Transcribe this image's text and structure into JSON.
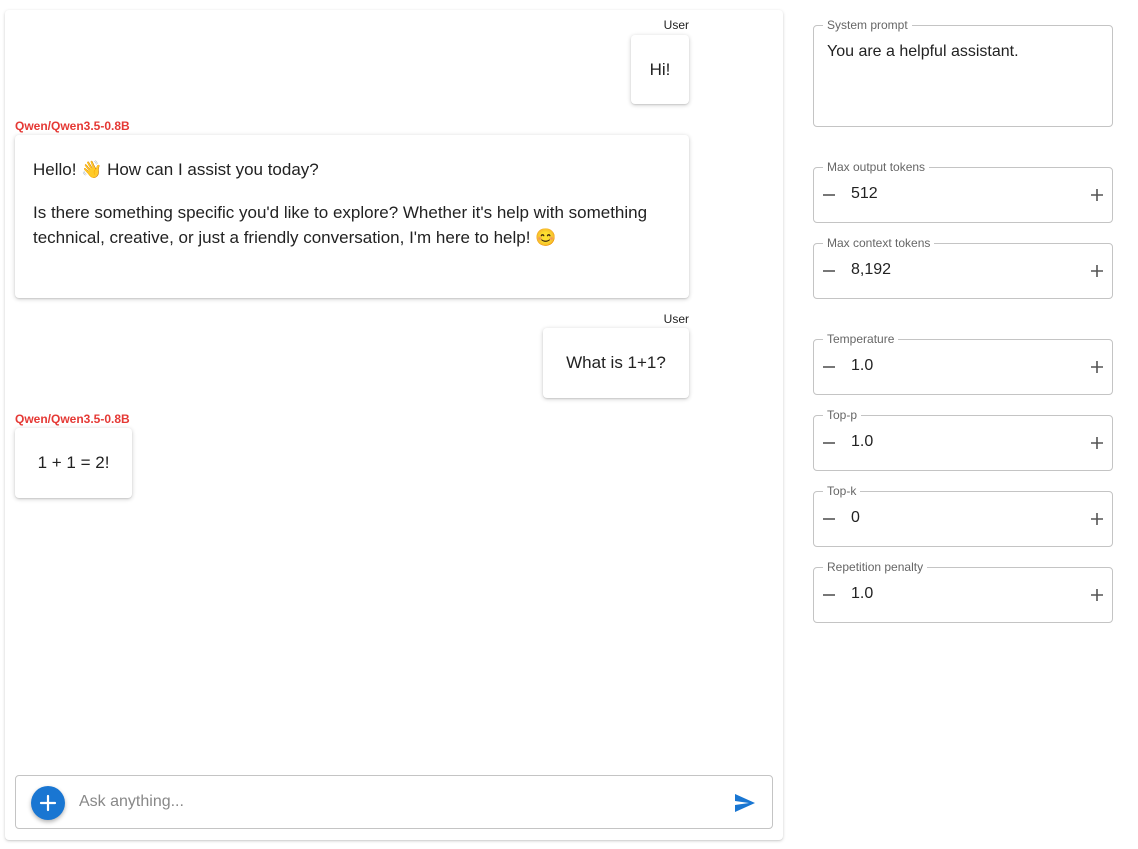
{
  "chat": {
    "messages": [
      {
        "role": "user",
        "sender": "User",
        "paragraphs": [
          "Hi!"
        ]
      },
      {
        "role": "assistant",
        "sender": "Qwen/Qwen3.5-0.8B",
        "paragraphs": [
          "Hello! 👋 How can I assist you today?",
          "Is there something specific you'd like to explore? Whether it's help with something technical, creative, or just a friendly conversation, I'm here to help! 😊"
        ]
      },
      {
        "role": "user",
        "sender": "User",
        "paragraphs": [
          "What is 1+1?"
        ]
      },
      {
        "role": "assistant",
        "sender": "Qwen/Qwen3.5-0.8B",
        "paragraphs": [
          "1 + 1 = 2!"
        ]
      }
    ],
    "input": {
      "placeholder": "Ask anything...",
      "value": ""
    }
  },
  "settings": {
    "system_prompt": {
      "label": "System prompt",
      "value": "You are a helpful assistant."
    },
    "max_output_tokens": {
      "label": "Max output tokens",
      "value": "512"
    },
    "max_context_tokens": {
      "label": "Max context tokens",
      "value": "8,192"
    },
    "temperature": {
      "label": "Temperature",
      "value": "1.0"
    },
    "top_p": {
      "label": "Top-p",
      "value": "1.0"
    },
    "top_k": {
      "label": "Top-k",
      "value": "0"
    },
    "repetition_penalty": {
      "label": "Repetition penalty",
      "value": "1.0"
    }
  },
  "colors": {
    "accent": "#1976d2",
    "assistant_name": "#e53935",
    "border": "#c4c4c4"
  },
  "icons": {
    "add": "plus-icon",
    "send": "send-icon",
    "decrement": "minus-icon",
    "increment": "plus-icon"
  }
}
